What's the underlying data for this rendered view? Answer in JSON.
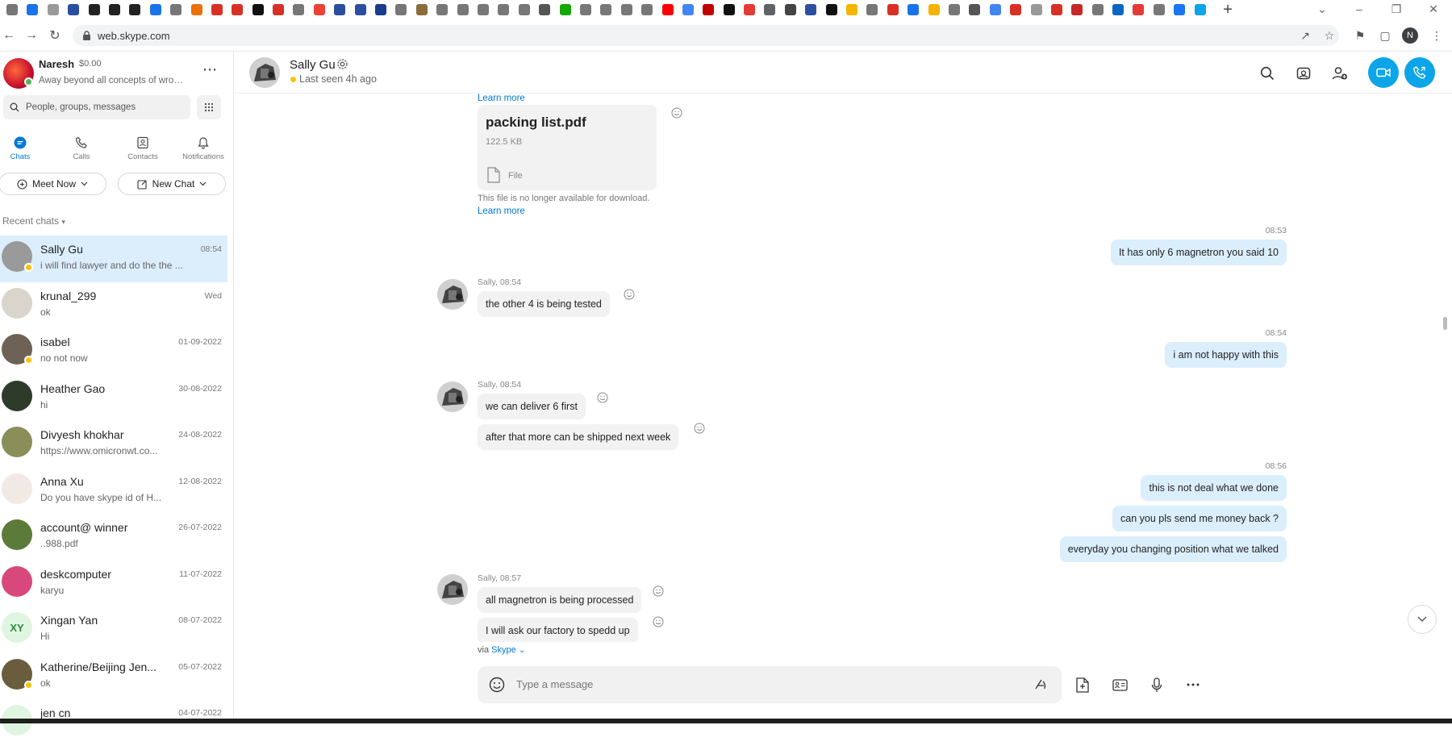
{
  "browser": {
    "url": "web.skype.com",
    "profile_initial": "N",
    "tabs": [
      {
        "name": "tab-favicon",
        "color": "#777777"
      },
      {
        "name": "tab-favicon",
        "color": "#1a73e8"
      },
      {
        "name": "tab-favicon",
        "color": "#999999"
      },
      {
        "name": "tab-favicon",
        "color": "#2b4ea0"
      },
      {
        "name": "tab-favicon",
        "color": "#222222"
      },
      {
        "name": "tab-favicon",
        "color": "#222222"
      },
      {
        "name": "tab-favicon",
        "color": "#222222"
      },
      {
        "name": "tab-favicon",
        "color": "#1a73e8"
      },
      {
        "name": "tab-favicon",
        "color": "#777777"
      },
      {
        "name": "tab-favicon",
        "color": "#e8710a"
      },
      {
        "name": "tab-favicon",
        "color": "#d93025"
      },
      {
        "name": "tab-favicon",
        "color": "#d93025"
      },
      {
        "name": "tab-favicon",
        "color": "#111111"
      },
      {
        "name": "tab-favicon",
        "color": "#d93025"
      },
      {
        "name": "tab-favicon",
        "color": "#777777"
      },
      {
        "name": "tab-favicon",
        "color": "#ea4335"
      },
      {
        "name": "tab-favicon",
        "color": "#2b4ea0"
      },
      {
        "name": "tab-favicon",
        "color": "#2b4ea0"
      },
      {
        "name": "tab-favicon",
        "color": "#1b3c8c"
      },
      {
        "name": "tab-favicon",
        "color": "#777777"
      },
      {
        "name": "tab-favicon",
        "color": "#8a6d3b"
      },
      {
        "name": "tab-favicon",
        "color": "#777777"
      },
      {
        "name": "tab-favicon",
        "color": "#777777"
      },
      {
        "name": "tab-favicon",
        "color": "#777777"
      },
      {
        "name": "tab-favicon",
        "color": "#777777"
      },
      {
        "name": "tab-favicon",
        "color": "#777777"
      },
      {
        "name": "tab-favicon",
        "color": "#555555"
      },
      {
        "name": "tab-favicon",
        "color": "#14a800"
      },
      {
        "name": "tab-favicon",
        "color": "#777777"
      },
      {
        "name": "tab-favicon",
        "color": "#777777"
      },
      {
        "name": "tab-favicon",
        "color": "#777777"
      },
      {
        "name": "tab-favicon",
        "color": "#777777"
      },
      {
        "name": "tab-favicon",
        "color": "#ff0000"
      },
      {
        "name": "tab-favicon",
        "color": "#4285f4"
      },
      {
        "name": "tab-favicon",
        "color": "#c00000"
      },
      {
        "name": "tab-favicon",
        "color": "#111111"
      },
      {
        "name": "tab-favicon",
        "color": "#e53935"
      },
      {
        "name": "tab-favicon",
        "color": "#5f6368"
      },
      {
        "name": "tab-favicon",
        "color": "#444444"
      },
      {
        "name": "tab-favicon",
        "color": "#2b4ea0"
      },
      {
        "name": "tab-favicon",
        "color": "#111111"
      },
      {
        "name": "tab-favicon",
        "color": "#f4b400"
      },
      {
        "name": "tab-favicon",
        "color": "#777777"
      },
      {
        "name": "tab-favicon",
        "color": "#d93025"
      },
      {
        "name": "tab-favicon",
        "color": "#1a73e8"
      },
      {
        "name": "tab-favicon",
        "color": "#f4b400"
      },
      {
        "name": "tab-favicon",
        "color": "#777777"
      },
      {
        "name": "tab-favicon",
        "color": "#555555"
      },
      {
        "name": "tab-favicon",
        "color": "#4285f4"
      },
      {
        "name": "tab-favicon",
        "color": "#d93025"
      },
      {
        "name": "tab-favicon",
        "color": "#999999"
      },
      {
        "name": "tab-favicon",
        "color": "#d93025"
      },
      {
        "name": "tab-favicon",
        "color": "#c62828"
      },
      {
        "name": "tab-favicon",
        "color": "#777777"
      },
      {
        "name": "tab-favicon",
        "color": "#0a66c2"
      },
      {
        "name": "tab-favicon",
        "color": "#e53935"
      },
      {
        "name": "tab-favicon",
        "color": "#777777"
      },
      {
        "name": "tab-favicon",
        "color": "#1877f2"
      },
      {
        "name": "tab-favicon",
        "color": "#0ba5e8"
      }
    ]
  },
  "colors": {
    "accent": "#0078d4",
    "call_button": "#0ba5e8",
    "outgoing_bubble": "#dbeefc",
    "incoming_bubble": "#f2f2f2",
    "away_status": "#ffc20a",
    "online_status": "#5bb45b"
  },
  "profile": {
    "name": "Naresh",
    "credit": "$0.00",
    "mood": "Away beyond all concepts of wrong..."
  },
  "search": {
    "placeholder": "People, groups, messages"
  },
  "nav_tabs": [
    {
      "label": "Chats",
      "icon": "chat-icon",
      "active": true
    },
    {
      "label": "Calls",
      "icon": "phone-icon",
      "active": false
    },
    {
      "label": "Contacts",
      "icon": "contacts-icon",
      "active": false
    },
    {
      "label": "Notifications",
      "icon": "bell-icon",
      "active": false
    }
  ],
  "actions": {
    "meet_now": "Meet Now",
    "new_chat": "New Chat"
  },
  "recent_chats_label": "Recent chats",
  "chats": [
    {
      "name": "Sally Gu",
      "time": "08:54",
      "preview": "i will find lawyer and do the the ...",
      "selected": true,
      "status": "away",
      "avatar_color": "#9a9a9a",
      "initials": ""
    },
    {
      "name": "krunal_299",
      "time": "Wed",
      "preview": "ok",
      "selected": false,
      "status": "",
      "avatar_color": "#d9d4cc",
      "initials": ""
    },
    {
      "name": "isabel",
      "time": "01-09-2022",
      "preview": "no not now",
      "selected": false,
      "status": "away",
      "avatar_color": "#6d6255",
      "initials": ""
    },
    {
      "name": "Heather Gao",
      "time": "30-08-2022",
      "preview": "hi",
      "selected": false,
      "status": "",
      "avatar_color": "#2f3b2a",
      "initials": ""
    },
    {
      "name": "Divyesh khokhar",
      "time": "24-08-2022",
      "preview": "https://www.omicronwt.co...",
      "selected": false,
      "status": "",
      "avatar_color": "#8a8f5a",
      "initials": ""
    },
    {
      "name": "Anna Xu",
      "time": "12-08-2022",
      "preview": "Do you have skype id of H...",
      "selected": false,
      "status": "",
      "avatar_color": "#f1e9e4",
      "initials": ""
    },
    {
      "name": "account@ winner",
      "time": "26-07-2022",
      "preview": "..988.pdf",
      "selected": false,
      "status": "",
      "avatar_color": "#5c7a3a",
      "initials": ""
    },
    {
      "name": "deskcomputer",
      "time": "11-07-2022",
      "preview": "karyu",
      "selected": false,
      "status": "",
      "avatar_color": "#d8487a",
      "initials": ""
    },
    {
      "name": "Xingan  Yan",
      "time": "08-07-2022",
      "preview": "Hi",
      "selected": false,
      "status": "",
      "avatar_color": "#dff5e2",
      "initials": "XY"
    },
    {
      "name": "Katherine/Beijing Jen...",
      "time": "05-07-2022",
      "preview": "ok",
      "selected": false,
      "status": "away",
      "avatar_color": "#6a5d3e",
      "initials": ""
    },
    {
      "name": "jen cn",
      "time": "04-07-2022",
      "preview": "",
      "selected": false,
      "status": "",
      "avatar_color": "#dff5e2",
      "initials": ""
    }
  ],
  "conversation": {
    "name": "Sally Gu",
    "status": "Last seen 4h ago",
    "learn_more": "Learn more",
    "file": {
      "name": "packing list.pdf",
      "size": "122.5 KB",
      "type": "File",
      "note": "This file is no longer available for download."
    },
    "outgoing": [
      {
        "time": "08:53",
        "messages": [
          "It has only 6 magnetron you said 10"
        ]
      },
      {
        "time": "08:54",
        "messages": [
          "i am not happy with this"
        ]
      },
      {
        "time": "08:56",
        "messages": [
          "this is not deal what we done",
          "can you pls send me money back ?",
          "everyday you changing position what we talked"
        ]
      }
    ],
    "incoming": [
      {
        "sender": "Sally, 08:54",
        "messages": [
          "the other 4 is being tested"
        ]
      },
      {
        "sender": "Sally, 08:54",
        "messages": [
          "we can deliver 6 first",
          "after that more can be shipped next week"
        ]
      },
      {
        "sender": "Sally, 08:57",
        "messages": [
          "all magnetron is being processed",
          "I will ask our factory to spedd up"
        ]
      }
    ],
    "via": "via",
    "via_app": "Skype"
  },
  "composer": {
    "placeholder": "Type a message"
  }
}
